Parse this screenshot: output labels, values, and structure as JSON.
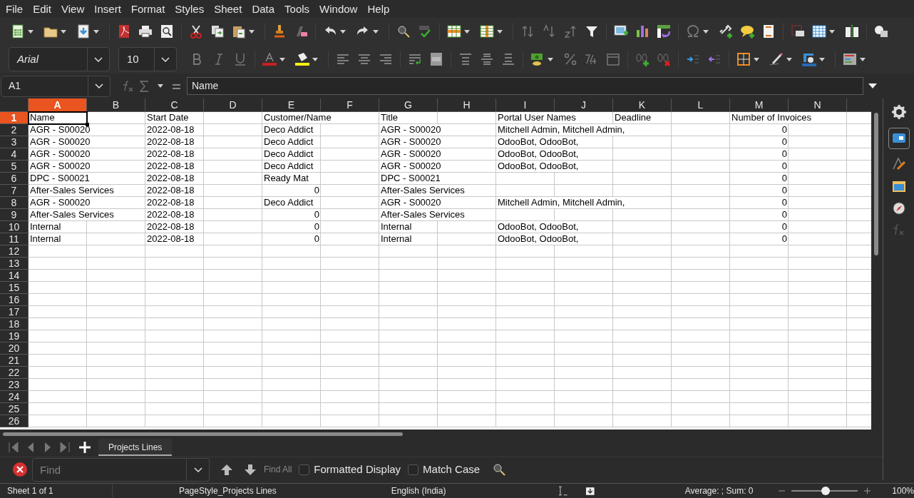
{
  "menu": [
    "File",
    "Edit",
    "View",
    "Insert",
    "Format",
    "Styles",
    "Sheet",
    "Data",
    "Tools",
    "Window",
    "Help"
  ],
  "font_name": {
    "value": "Arial"
  },
  "font_size": {
    "value": "10"
  },
  "name_box": {
    "value": "A1"
  },
  "formula": {
    "value": "Name"
  },
  "sheet": {
    "columns": [
      {
        "label": "A",
        "selected": true
      },
      {
        "label": "B",
        "selected": false
      },
      {
        "label": "C",
        "selected": false
      },
      {
        "label": "D",
        "selected": false
      },
      {
        "label": "E",
        "selected": false
      },
      {
        "label": "F",
        "selected": false
      },
      {
        "label": "G",
        "selected": false
      },
      {
        "label": "H",
        "selected": false
      },
      {
        "label": "I",
        "selected": false
      },
      {
        "label": "J",
        "selected": false
      },
      {
        "label": "K",
        "selected": false
      },
      {
        "label": "L",
        "selected": false
      },
      {
        "label": "M",
        "selected": false
      },
      {
        "label": "N",
        "selected": false
      }
    ],
    "rows": [
      {
        "label": "1",
        "selected": true,
        "cells": [
          {
            "text": "Name",
            "kind": "text",
            "selected": true
          },
          {
            "kind": "empty"
          },
          {
            "text": "Start Date",
            "kind": "text",
            "selected": false
          },
          {
            "kind": "empty"
          },
          {
            "text": "Customer/Name",
            "kind": "text",
            "selected": false
          },
          {
            "kind": "empty"
          },
          {
            "text": "Title",
            "kind": "text",
            "selected": false
          },
          {
            "kind": "empty"
          },
          {
            "text": "Portal User Names",
            "kind": "text",
            "selected": false
          },
          {
            "kind": "empty"
          },
          {
            "text": "Deadline",
            "kind": "text",
            "selected": false
          },
          {
            "kind": "empty"
          },
          {
            "text": "Number of Invoices",
            "kind": "text",
            "selected": false
          },
          {
            "kind": "empty"
          }
        ]
      },
      {
        "label": "2",
        "selected": false,
        "cells": [
          {
            "text": "AGR - S00020",
            "kind": "text",
            "selected": false
          },
          {
            "kind": "empty"
          },
          {
            "text": "2022-08-18",
            "kind": "text",
            "selected": false
          },
          {
            "kind": "empty"
          },
          {
            "text": "Deco Addict",
            "kind": "text",
            "selected": false
          },
          {
            "kind": "empty"
          },
          {
            "text": "AGR - S00020",
            "kind": "text",
            "selected": false
          },
          {
            "kind": "empty"
          },
          {
            "text": "Mitchell Admin, Mitchell Admin,",
            "kind": "text",
            "selected": false
          },
          {
            "kind": "empty"
          },
          {
            "kind": "empty"
          },
          {
            "kind": "empty"
          },
          {
            "text": "0",
            "kind": "number",
            "selected": false
          },
          {
            "kind": "empty"
          }
        ]
      },
      {
        "label": "3",
        "selected": false,
        "cells": [
          {
            "text": "AGR - S00020",
            "kind": "text",
            "selected": false
          },
          {
            "kind": "empty"
          },
          {
            "text": "2022-08-18",
            "kind": "text",
            "selected": false
          },
          {
            "kind": "empty"
          },
          {
            "text": "Deco Addict",
            "kind": "text",
            "selected": false
          },
          {
            "kind": "empty"
          },
          {
            "text": "AGR - S00020",
            "kind": "text",
            "selected": false
          },
          {
            "kind": "empty"
          },
          {
            "text": "OdooBot, OdooBot,",
            "kind": "text",
            "selected": false
          },
          {
            "kind": "empty"
          },
          {
            "kind": "empty"
          },
          {
            "kind": "empty"
          },
          {
            "text": "0",
            "kind": "number",
            "selected": false
          },
          {
            "kind": "empty"
          }
        ]
      },
      {
        "label": "4",
        "selected": false,
        "cells": [
          {
            "text": "AGR - S00020",
            "kind": "text",
            "selected": false
          },
          {
            "kind": "empty"
          },
          {
            "text": "2022-08-18",
            "kind": "text",
            "selected": false
          },
          {
            "kind": "empty"
          },
          {
            "text": "Deco Addict",
            "kind": "text",
            "selected": false
          },
          {
            "kind": "empty"
          },
          {
            "text": "AGR - S00020",
            "kind": "text",
            "selected": false
          },
          {
            "kind": "empty"
          },
          {
            "text": "OdooBot, OdooBot,",
            "kind": "text",
            "selected": false
          },
          {
            "kind": "empty"
          },
          {
            "kind": "empty"
          },
          {
            "kind": "empty"
          },
          {
            "text": "0",
            "kind": "number",
            "selected": false
          },
          {
            "kind": "empty"
          }
        ]
      },
      {
        "label": "5",
        "selected": false,
        "cells": [
          {
            "text": "AGR - S00020",
            "kind": "text",
            "selected": false
          },
          {
            "kind": "empty"
          },
          {
            "text": "2022-08-18",
            "kind": "text",
            "selected": false
          },
          {
            "kind": "empty"
          },
          {
            "text": "Deco Addict",
            "kind": "text",
            "selected": false
          },
          {
            "kind": "empty"
          },
          {
            "text": "AGR - S00020",
            "kind": "text",
            "selected": false
          },
          {
            "kind": "empty"
          },
          {
            "text": "OdooBot, OdooBot,",
            "kind": "text",
            "selected": false
          },
          {
            "kind": "empty"
          },
          {
            "kind": "empty"
          },
          {
            "kind": "empty"
          },
          {
            "text": "0",
            "kind": "number",
            "selected": false
          },
          {
            "kind": "empty"
          }
        ]
      },
      {
        "label": "6",
        "selected": false,
        "cells": [
          {
            "text": "DPC - S00021",
            "kind": "text",
            "selected": false
          },
          {
            "kind": "empty"
          },
          {
            "text": "2022-08-18",
            "kind": "text",
            "selected": false
          },
          {
            "kind": "empty"
          },
          {
            "text": "Ready Mat",
            "kind": "text",
            "selected": false
          },
          {
            "kind": "empty"
          },
          {
            "text": "DPC - S00021",
            "kind": "text",
            "selected": false
          },
          {
            "kind": "empty"
          },
          {
            "kind": "empty"
          },
          {
            "kind": "empty"
          },
          {
            "kind": "empty"
          },
          {
            "kind": "empty"
          },
          {
            "text": "0",
            "kind": "number",
            "selected": false
          },
          {
            "kind": "empty"
          }
        ]
      },
      {
        "label": "7",
        "selected": false,
        "cells": [
          {
            "text": "After-Sales Services",
            "kind": "text",
            "selected": false
          },
          {
            "kind": "empty"
          },
          {
            "text": "2022-08-18",
            "kind": "text",
            "selected": false
          },
          {
            "kind": "empty"
          },
          {
            "text": "0",
            "kind": "number",
            "selected": false
          },
          {
            "kind": "empty"
          },
          {
            "text": "After-Sales Services",
            "kind": "text",
            "selected": false
          },
          {
            "kind": "empty"
          },
          {
            "kind": "empty"
          },
          {
            "kind": "empty"
          },
          {
            "kind": "empty"
          },
          {
            "kind": "empty"
          },
          {
            "text": "0",
            "kind": "number",
            "selected": false
          },
          {
            "kind": "empty"
          }
        ]
      },
      {
        "label": "8",
        "selected": false,
        "cells": [
          {
            "text": "AGR - S00020",
            "kind": "text",
            "selected": false
          },
          {
            "kind": "empty"
          },
          {
            "text": "2022-08-18",
            "kind": "text",
            "selected": false
          },
          {
            "kind": "empty"
          },
          {
            "text": "Deco Addict",
            "kind": "text",
            "selected": false
          },
          {
            "kind": "empty"
          },
          {
            "text": "AGR - S00020",
            "kind": "text",
            "selected": false
          },
          {
            "kind": "empty"
          },
          {
            "text": "Mitchell Admin, Mitchell Admin,",
            "kind": "text",
            "selected": false
          },
          {
            "kind": "empty"
          },
          {
            "kind": "empty"
          },
          {
            "kind": "empty"
          },
          {
            "text": "0",
            "kind": "number",
            "selected": false
          },
          {
            "kind": "empty"
          }
        ]
      },
      {
        "label": "9",
        "selected": false,
        "cells": [
          {
            "text": "After-Sales Services",
            "kind": "text",
            "selected": false
          },
          {
            "kind": "empty"
          },
          {
            "text": "2022-08-18",
            "kind": "text",
            "selected": false
          },
          {
            "kind": "empty"
          },
          {
            "text": "0",
            "kind": "number",
            "selected": false
          },
          {
            "kind": "empty"
          },
          {
            "text": "After-Sales Services",
            "kind": "text",
            "selected": false
          },
          {
            "kind": "empty"
          },
          {
            "kind": "empty"
          },
          {
            "kind": "empty"
          },
          {
            "kind": "empty"
          },
          {
            "kind": "empty"
          },
          {
            "text": "0",
            "kind": "number",
            "selected": false
          },
          {
            "kind": "empty"
          }
        ]
      },
      {
        "label": "10",
        "selected": false,
        "cells": [
          {
            "text": "Internal",
            "kind": "text",
            "selected": false
          },
          {
            "kind": "empty"
          },
          {
            "text": "2022-08-18",
            "kind": "text",
            "selected": false
          },
          {
            "kind": "empty"
          },
          {
            "text": "0",
            "kind": "number",
            "selected": false
          },
          {
            "kind": "empty"
          },
          {
            "text": "Internal",
            "kind": "text",
            "selected": false
          },
          {
            "kind": "empty"
          },
          {
            "text": "OdooBot, OdooBot,",
            "kind": "text",
            "selected": false
          },
          {
            "kind": "empty"
          },
          {
            "kind": "empty"
          },
          {
            "kind": "empty"
          },
          {
            "text": "0",
            "kind": "number",
            "selected": false
          },
          {
            "kind": "empty"
          }
        ]
      },
      {
        "label": "11",
        "selected": false,
        "cells": [
          {
            "text": "Internal",
            "kind": "text",
            "selected": false
          },
          {
            "kind": "empty"
          },
          {
            "text": "2022-08-18",
            "kind": "text",
            "selected": false
          },
          {
            "kind": "empty"
          },
          {
            "text": "0",
            "kind": "number",
            "selected": false
          },
          {
            "kind": "empty"
          },
          {
            "text": "Internal",
            "kind": "text",
            "selected": false
          },
          {
            "kind": "empty"
          },
          {
            "text": "OdooBot, OdooBot,",
            "kind": "text",
            "selected": false
          },
          {
            "kind": "empty"
          },
          {
            "kind": "empty"
          },
          {
            "kind": "empty"
          },
          {
            "text": "0",
            "kind": "number",
            "selected": false
          },
          {
            "kind": "empty"
          }
        ]
      },
      {
        "label": "12",
        "selected": false
      },
      {
        "label": "13",
        "selected": false
      },
      {
        "label": "14",
        "selected": false
      },
      {
        "label": "15",
        "selected": false
      },
      {
        "label": "16",
        "selected": false
      },
      {
        "label": "17",
        "selected": false
      },
      {
        "label": "18",
        "selected": false
      },
      {
        "label": "19",
        "selected": false
      },
      {
        "label": "20",
        "selected": false
      },
      {
        "label": "21",
        "selected": false
      },
      {
        "label": "22",
        "selected": false
      },
      {
        "label": "23",
        "selected": false
      },
      {
        "label": "24",
        "selected": false
      },
      {
        "label": "25",
        "selected": false
      },
      {
        "label": "26",
        "selected": false
      }
    ]
  },
  "tabs": [
    {
      "label": "Projects Lines",
      "selected": true
    }
  ],
  "find_bar": {
    "placeholder": "Find",
    "find_all": "Find All",
    "options": [
      {
        "label": "Formatted Display",
        "checked": false
      },
      {
        "label": "Match Case",
        "checked": false
      }
    ]
  },
  "status_bar": {
    "sheet": "Sheet 1 of 1",
    "page_style": "PageStyle_Projects Lines",
    "language": "English (India)",
    "summary": "Average: ; Sum: 0",
    "zoom": {
      "level": 0.52,
      "reading": "100%"
    }
  }
}
